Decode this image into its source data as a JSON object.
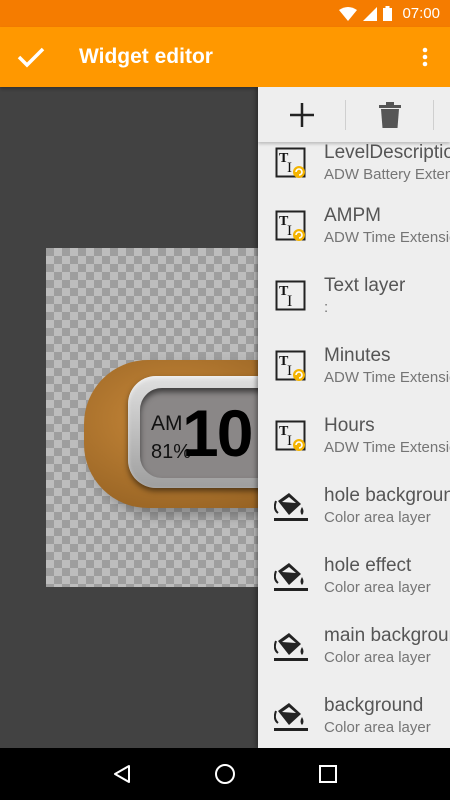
{
  "status_bar": {
    "time": "07:00",
    "icons": [
      "wifi-icon",
      "signal-icon",
      "battery-icon"
    ]
  },
  "toolbar": {
    "title": "Widget editor",
    "confirm_icon": "check-icon",
    "menu_icon": "more-vert-icon"
  },
  "colors": {
    "status_bar": "#f57c00",
    "toolbar": "#ff9800",
    "canvas": "#424242",
    "panel": "#eeeeee"
  },
  "preview": {
    "ampm": "AM",
    "level": "81%",
    "hours": "10"
  },
  "panel": {
    "add_icon": "plus-icon",
    "delete_icon": "trash-icon",
    "layers": [
      {
        "name": "LevelDescription",
        "sub": "ADW Battery Extension",
        "icon": "text-ext-layer-icon"
      },
      {
        "name": "AMPM",
        "sub": "ADW Time Extension",
        "icon": "text-ext-layer-icon"
      },
      {
        "name": "Text layer",
        "sub": ":",
        "icon": "text-layer-icon"
      },
      {
        "name": "Minutes",
        "sub": "ADW Time Extension",
        "icon": "text-ext-layer-icon"
      },
      {
        "name": "Hours",
        "sub": "ADW Time Extension",
        "icon": "text-ext-layer-icon"
      },
      {
        "name": "hole background",
        "sub": "Color area layer",
        "icon": "paint-bucket-icon"
      },
      {
        "name": "hole effect",
        "sub": "Color area layer",
        "icon": "paint-bucket-icon"
      },
      {
        "name": "main background",
        "sub": "Color area layer",
        "icon": "paint-bucket-icon"
      },
      {
        "name": "background",
        "sub": "Color area layer",
        "icon": "paint-bucket-icon"
      }
    ]
  },
  "nav_bar": {
    "back_icon": "back-triangle-icon",
    "home_icon": "home-circle-icon",
    "recents_icon": "recents-square-icon"
  }
}
